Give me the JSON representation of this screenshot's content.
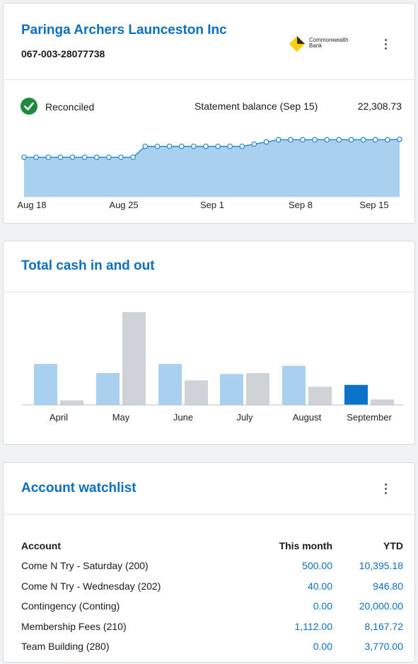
{
  "account_card": {
    "org_name": "Paringa Archers Launceston Inc",
    "account_number": "067-003-28077738",
    "bank_logo_line1": "Commonwealth",
    "bank_logo_line2": "Bank",
    "status": "Reconciled",
    "statement_label": "Statement balance (Sep 15)",
    "statement_balance": "22,308.73",
    "x_ticks": [
      "Aug 18",
      "Aug 25",
      "Sep 1",
      "Sep 8",
      "Sep 15"
    ]
  },
  "cash_card": {
    "title": "Total cash in and out"
  },
  "watchlist": {
    "title": "Account watchlist",
    "headers": {
      "account": "Account",
      "this_month": "This month",
      "ytd": "YTD"
    },
    "rows": [
      {
        "account": "Come N Try - Saturday (200)",
        "this_month": "500.00",
        "ytd": "10,395.18"
      },
      {
        "account": "Come N Try - Wednesday (202)",
        "this_month": "40.00",
        "ytd": "946.80"
      },
      {
        "account": "Contingency (Conting)",
        "this_month": "0.00",
        "ytd": "20,000.00"
      },
      {
        "account": "Membership Fees (210)",
        "this_month": "1,112.00",
        "ytd": "8,167.72"
      },
      {
        "account": "Team Building (280)",
        "this_month": "0.00",
        "ytd": "3,770.00"
      }
    ]
  },
  "colors": {
    "accent": "#0c6fc0",
    "reconciled_green": "#1e8a3c",
    "area_fill": "#a9d0ee",
    "cash_in": "#a9d0ee",
    "cash_out": "#cfd2d6",
    "current_month": "#0a72c8",
    "logo_yellow": "#ffcc00"
  },
  "chart_data": [
    {
      "type": "area",
      "title": "",
      "x_ticks": [
        "Aug 18",
        "Aug 25",
        "Sep 1",
        "Sep 8",
        "Sep 15"
      ],
      "xlabel": "",
      "ylabel": "",
      "values": [
        21900,
        21900,
        21900,
        21900,
        21900,
        21900,
        21900,
        21900,
        21900,
        21900,
        22150,
        22150,
        22150,
        22150,
        22150,
        22150,
        22150,
        22150,
        22150,
        22200,
        22250,
        22300,
        22300,
        22300,
        22300,
        22300,
        22300,
        22300,
        22300,
        22300,
        22300,
        22308.73
      ],
      "grid": false
    },
    {
      "type": "bar",
      "title": "",
      "categories": [
        "April",
        "May",
        "June",
        "July",
        "August",
        "September"
      ],
      "series": [
        {
          "values": [
            45,
            35,
            45,
            34,
            43,
            22
          ]
        },
        {
          "values": [
            5,
            102,
            27,
            35,
            20,
            6
          ]
        }
      ],
      "grid": false
    }
  ]
}
